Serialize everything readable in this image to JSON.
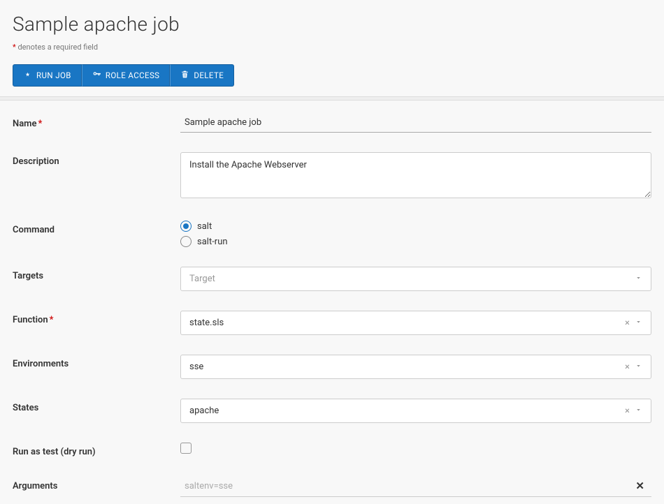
{
  "title": "Sample apache job",
  "required_note_prefix": "*",
  "required_note_text": " denotes a required field",
  "toolbar": {
    "run_label": "RUN JOB",
    "role_access_label": "ROLE ACCESS",
    "delete_label": "DELETE"
  },
  "labels": {
    "name": "Name",
    "description": "Description",
    "command": "Command",
    "targets": "Targets",
    "function": "Function",
    "environments": "Environments",
    "states": "States",
    "dry_run": "Run as test (dry run)",
    "arguments": "Arguments"
  },
  "fields": {
    "name": "Sample apache job",
    "description": "Install the Apache Webserver",
    "command": {
      "selected": "salt",
      "options": [
        "salt",
        "salt-run"
      ]
    },
    "targets": {
      "value": "",
      "placeholder": "Target"
    },
    "function": {
      "value": "state.sls"
    },
    "environments": {
      "value": "sse"
    },
    "states": {
      "value": "apache"
    },
    "dry_run": false,
    "arguments": {
      "value": "",
      "placeholder": "saltenv=sse"
    }
  }
}
